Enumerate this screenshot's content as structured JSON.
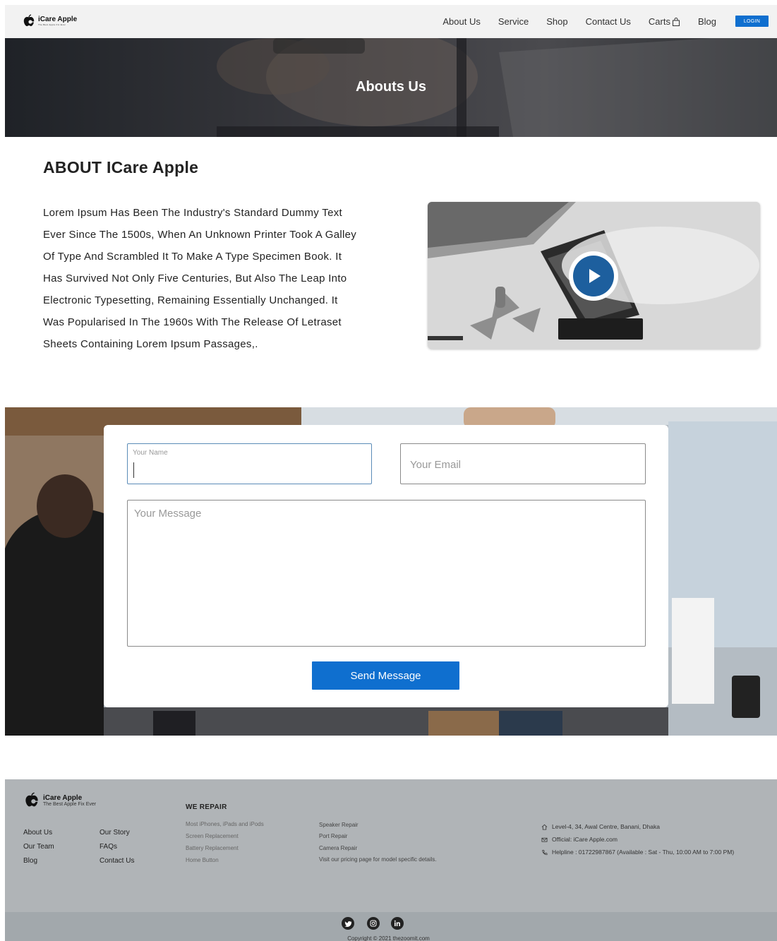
{
  "nav": {
    "brand_name": "iCare Apple",
    "brand_tag": "The Best Apple Fix Ever",
    "links": [
      "About Us",
      "Service",
      "Shop",
      "Contact Us",
      "Carts",
      "Blog"
    ],
    "login": "LOGIN"
  },
  "hero": {
    "title": "Abouts Us"
  },
  "about": {
    "heading": "ABOUT ICare Apple",
    "body": "Lorem Ipsum Has Been The Industry's Standard Dummy Text Ever Since The 1500s, When An Unknown Printer Took A Galley Of Type And Scrambled It To Make A Type Specimen Book. It Has Survived Not Only Five Centuries, But Also The Leap Into Electronic Typesetting, Remaining Essentially Unchanged. It Was Popularised In The 1960s With The Release Of Letraset Sheets Containing Lorem Ipsum Passages,."
  },
  "contact": {
    "name_label": "Your Name",
    "name_value": "",
    "email_placeholder": "Your Email",
    "message_placeholder": "Your Message",
    "send": "Send Message"
  },
  "footer": {
    "brand_name": "iCare Apple",
    "brand_tag": "The Best Apple Fix Ever",
    "col1": [
      "About Us",
      "Our Team",
      "Blog"
    ],
    "col2": [
      "Our Story",
      "FAQs",
      "Contact Us"
    ],
    "we_repair_heading": "WE REPAIR",
    "repair_col1": [
      "Most iPhones, iPads and iPods",
      "Screen Replacement",
      "Battery Replacement",
      "Home Button"
    ],
    "repair_col2": [
      "Speaker Repair",
      "Port Repair",
      "Camera Repair",
      "Visit our pricing page for model specific details."
    ],
    "address": "Level-4, 34, Awal Centre, Banani, Dhaka",
    "email": "Official: iCare Apple.com",
    "helpline": "Helpline : 01722987867 (Available : Sat - Thu, 10:00 AM to 7:00 PM)",
    "copyright": "Copyright © 2021 thezoomit.com"
  },
  "colors": {
    "accent": "#0f6fcf",
    "footer_bg": "#b0b4b7"
  },
  "icons": [
    "apple-logo-icon",
    "cart-icon",
    "play-icon",
    "home-icon",
    "mail-icon",
    "phone-icon",
    "twitter-icon",
    "instagram-icon",
    "linkedin-icon"
  ]
}
